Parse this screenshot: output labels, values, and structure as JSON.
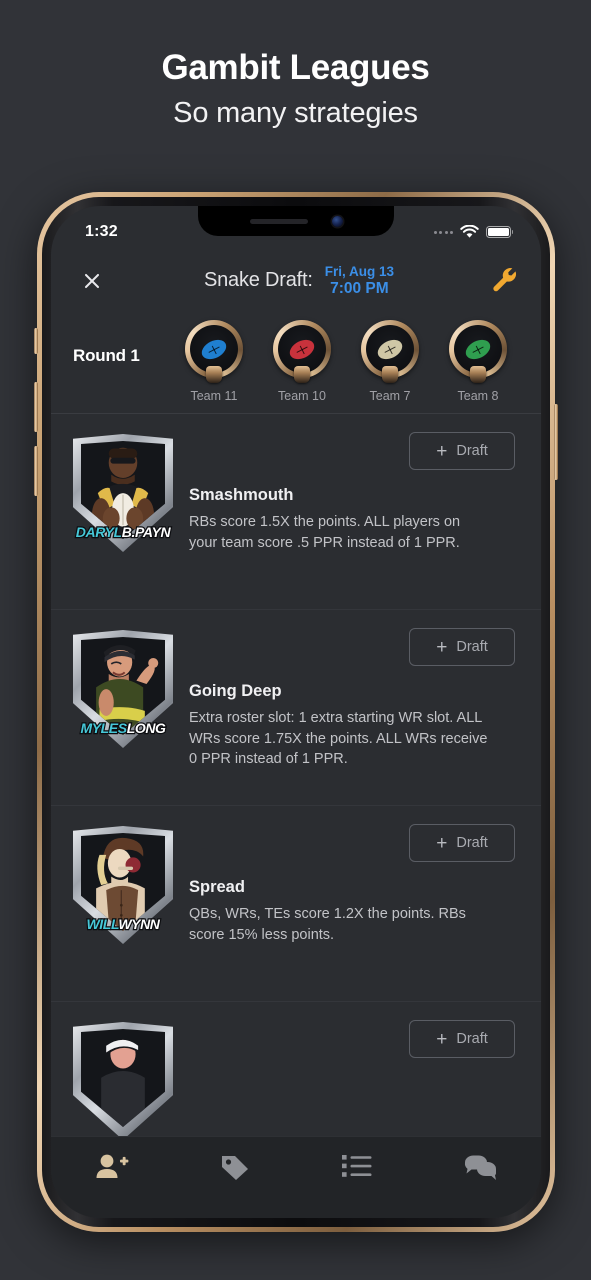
{
  "promo": {
    "title": "Gambit Leagues",
    "subtitle": "So many strategies"
  },
  "colors": {
    "page_bg": "#313338",
    "screen_bg": "#2b2d31",
    "accent_blue": "#3b8fe8",
    "accent_orange": "#f0a830",
    "nameplate_cyan": "#46c8d8",
    "tab_active": "#d8c3a0",
    "tab_inactive": "#8e9095"
  },
  "status_bar": {
    "time": "1:32",
    "signal_icon": "signal-dots-icon",
    "wifi_icon": "wifi-icon",
    "battery_icon": "battery-full-icon"
  },
  "nav": {
    "close_icon": "close-icon",
    "title": "Snake Draft:",
    "date": "Fri, Aug 13",
    "time": "7:00 PM",
    "settings_icon": "wrench-icon"
  },
  "round": {
    "label": "Round 1",
    "teams": [
      {
        "name": "Team 11",
        "ball_color": "#1f7fd0",
        "icon": "football-icon"
      },
      {
        "name": "Team 10",
        "ball_color": "#c8323c",
        "icon": "football-icon"
      },
      {
        "name": "Team 7",
        "ball_color": "#cfc7a6",
        "icon": "football-icon"
      },
      {
        "name": "Team 8",
        "ball_color": "#2f9e4f",
        "icon": "football-icon"
      }
    ]
  },
  "draft_button": {
    "plus_icon": "plus-icon",
    "label": "Draft"
  },
  "strategies": [
    {
      "title": "Smashmouth",
      "description": "RBs score 1.5X the points. ALL players on your team score .5 PPR instead of 1 PPR.",
      "character_first": "DARYL",
      "character_last": "B.PAYN",
      "avatar_icon": "character-daryl-icon"
    },
    {
      "title": "Going Deep",
      "description": "Extra roster slot: 1 extra starting WR slot. ALL WRs score 1.75X the points. ALL WRs receive 0 PPR instead of 1 PPR.",
      "character_first": "MYLES",
      "character_last": "LONG",
      "avatar_icon": "character-myles-icon"
    },
    {
      "title": "Spread",
      "description": "QBs, WRs, TEs score 1.2X the points. RBs score 15% less points.",
      "character_first": "WILL",
      "character_last": "WYNN",
      "avatar_icon": "character-will-icon"
    },
    {
      "title": "",
      "description": "",
      "character_first": "",
      "character_last": "",
      "avatar_icon": "character-partial-icon"
    }
  ],
  "tabbar": {
    "items": [
      {
        "icon": "add-person-icon",
        "active": true
      },
      {
        "icon": "tag-icon",
        "active": false
      },
      {
        "icon": "list-icon",
        "active": false
      },
      {
        "icon": "chat-icon",
        "active": false
      }
    ]
  }
}
